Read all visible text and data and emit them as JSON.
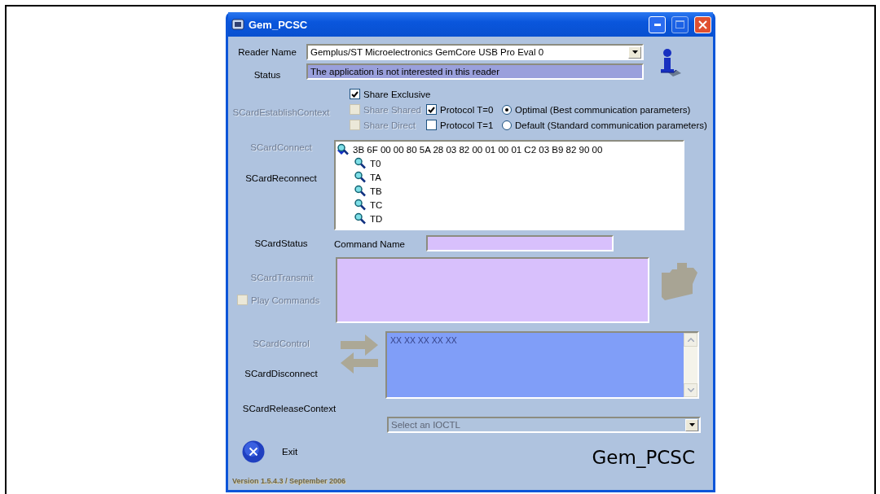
{
  "window": {
    "title": "Gem_PCSC"
  },
  "reader_name": {
    "label": "Reader Name",
    "value": "Gemplus/ST Microelectronics GemCore USB Pro Eval 0"
  },
  "status": {
    "label": "Status",
    "value": "The application is not interested in this reader"
  },
  "share_modes": [
    {
      "label": "Share Exclusive",
      "checked": true,
      "disabled": false
    },
    {
      "label": "Share Shared",
      "checked": false,
      "disabled": true
    },
    {
      "label": "Share Direct",
      "checked": false,
      "disabled": true
    }
  ],
  "protocols": [
    {
      "label": "Protocol T=0",
      "checked": true
    },
    {
      "label": "Protocol T=1",
      "checked": false
    }
  ],
  "parameters": [
    {
      "label": "Optimal (Best communication parameters)",
      "selected": true
    },
    {
      "label": "Default (Standard communication parameters)",
      "selected": false
    }
  ],
  "functions": [
    {
      "label": "SCardEstablishContext",
      "disabled": true
    },
    {
      "label": "SCardConnect",
      "disabled": true
    },
    {
      "label": "SCardReconnect",
      "disabled": false
    },
    {
      "label": "SCardStatus",
      "disabled": false
    },
    {
      "label": "SCardTransmit",
      "disabled": true
    },
    {
      "label": "SCardControl",
      "disabled": true
    },
    {
      "label": "SCardDisconnect",
      "disabled": false
    },
    {
      "label": "SCardReleaseContext",
      "disabled": false
    }
  ],
  "play_commands": {
    "label": "Play Commands",
    "checked": false,
    "disabled": true
  },
  "atr_tree": {
    "label": "3B 6F 00 00 80 5A 28 03 82 00 01 00 01 C2 03 B9 82 90 00",
    "children": [
      {
        "label": "T0"
      },
      {
        "label": "TA"
      },
      {
        "label": "TB"
      },
      {
        "label": "TC"
      },
      {
        "label": "TD"
      }
    ]
  },
  "command_name": {
    "label": "Command Name"
  },
  "control_output": {
    "placeholder": "XX XX XX XX XX"
  },
  "ioctl_select": {
    "placeholder": "Select an IOCTL"
  },
  "exit_button": {
    "label": "Exit"
  },
  "logo": "Gem_PCSC",
  "version": "Version 1.5.4.3 / September 2006"
}
